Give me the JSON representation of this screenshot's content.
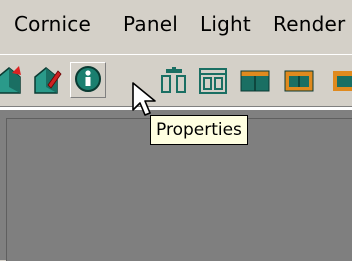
{
  "menu": {
    "items": [
      "Cornice",
      "Panel",
      "Light",
      "Render"
    ]
  },
  "toolbar": {
    "buttons": [
      {
        "icon": "house-red-arrow-icon"
      },
      {
        "icon": "house-pencil-icon"
      },
      {
        "icon": "info-icon"
      },
      {
        "icon": "columns-small-icon"
      },
      {
        "icon": "columns-frame-icon"
      },
      {
        "icon": "window-orange-icon"
      },
      {
        "icon": "window-orange-icon-2"
      }
    ]
  },
  "tooltip": {
    "text": "Properties"
  },
  "colors": {
    "chrome": "#d4d0c8",
    "viewport": "#808080",
    "tooltip_bg": "#ffffe1",
    "icon_teal": "#1a8a7a",
    "icon_orange": "#e08a1e"
  }
}
